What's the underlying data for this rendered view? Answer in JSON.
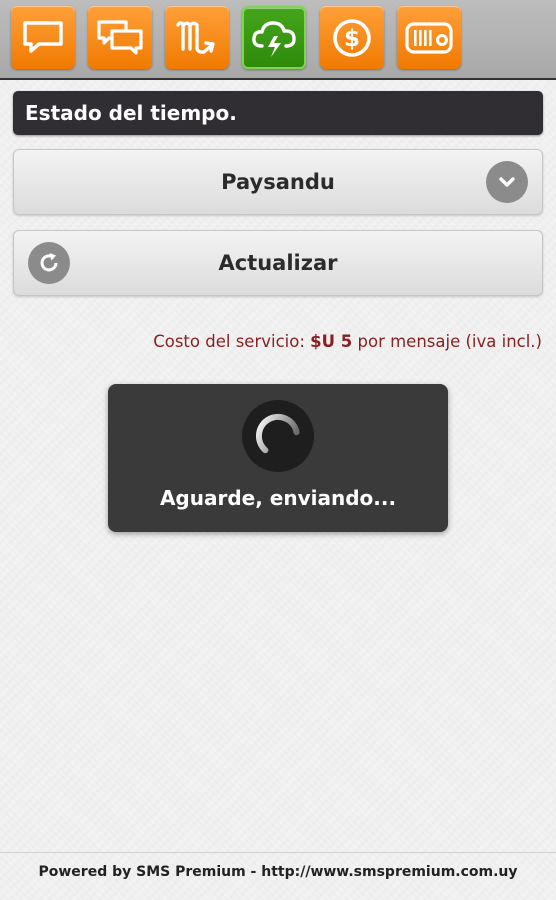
{
  "tabs": [
    {
      "icon": "chat-bubble-icon",
      "active": false
    },
    {
      "icon": "chat-bubbles-icon",
      "active": false
    },
    {
      "icon": "scorpio-icon",
      "active": false
    },
    {
      "icon": "weather-cloud-icon",
      "active": true
    },
    {
      "icon": "dollar-coin-icon",
      "active": false
    },
    {
      "icon": "radio-icon",
      "active": false
    }
  ],
  "header": {
    "title": "Estado del tiempo."
  },
  "city_select": {
    "value": "Paysandu",
    "icon": "chevron-down-icon"
  },
  "refresh_button": {
    "label": "Actualizar",
    "icon": "refresh-icon"
  },
  "cost": {
    "prefix": "Costo del servicio:",
    "amount": "$U 5",
    "suffix": "por mensaje (iva incl.)"
  },
  "loading": {
    "text": "Aguarde, enviando..."
  },
  "footer": {
    "text": "Powered by SMS Premium - http://www.smspremium.com.uy"
  },
  "colors": {
    "accent_orange": "#f58a1a",
    "active_green": "#3a9a12",
    "header_dark": "#302e33",
    "cost_text": "#8a1f1f"
  }
}
